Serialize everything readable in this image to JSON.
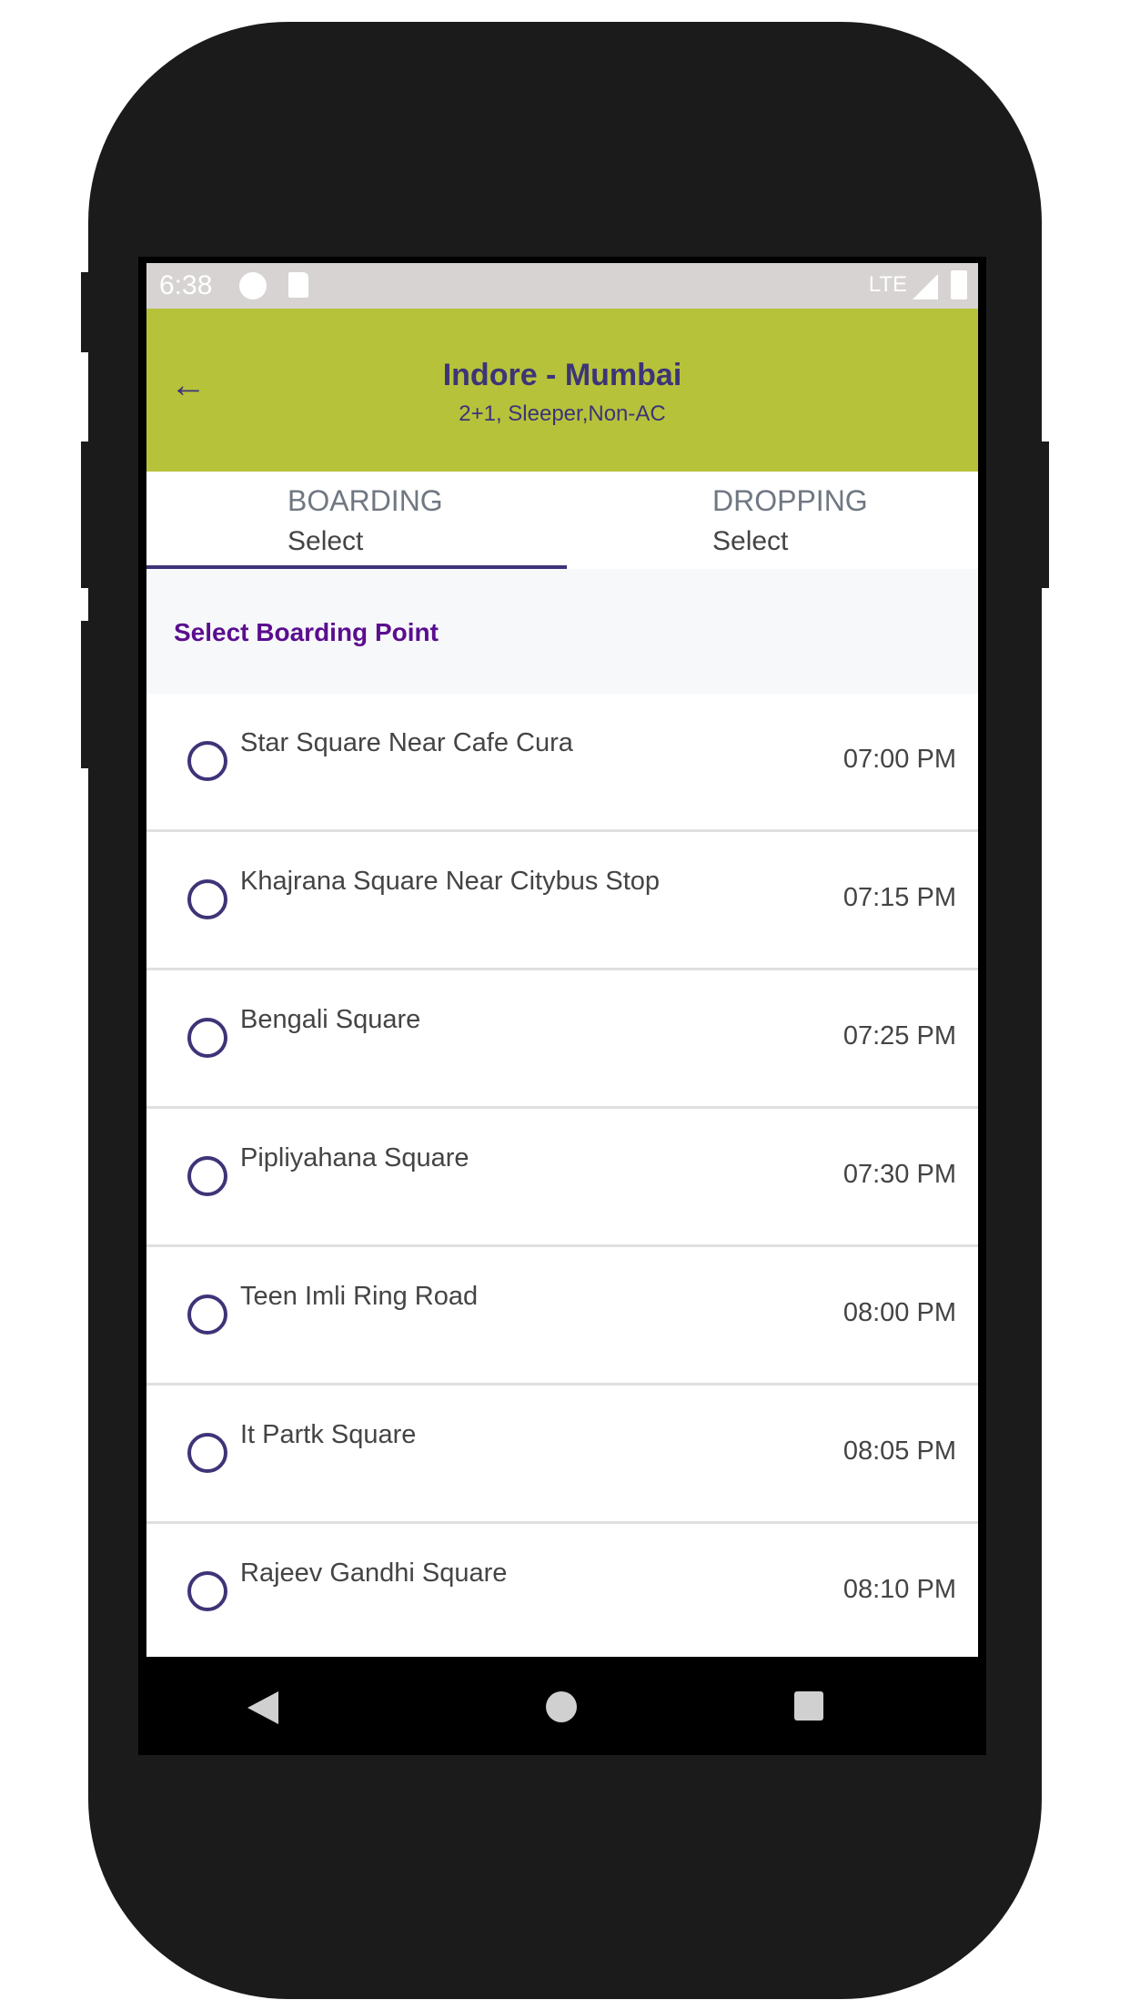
{
  "status_bar": {
    "time": "6:38",
    "network": "LTE",
    "icons": [
      "notification-icon",
      "sd-card-icon",
      "signal-icon",
      "battery-icon"
    ]
  },
  "header": {
    "title": "Indore - Mumbai",
    "subtitle": "2+1, Sleeper,Non-AC",
    "back_icon": "arrow-left-icon"
  },
  "tabs": [
    {
      "label": "BOARDING",
      "value": "Select",
      "active": true
    },
    {
      "label": "DROPPING",
      "value": "Select",
      "active": false
    }
  ],
  "section": {
    "heading": "Select Boarding Point"
  },
  "boarding_points": [
    {
      "name": "Star Square Near Cafe Cura",
      "time": "07:00 PM"
    },
    {
      "name": "Khajrana Square Near Citybus Stop",
      "time": "07:15 PM"
    },
    {
      "name": "Bengali Square",
      "time": "07:25 PM"
    },
    {
      "name": "Pipliyahana Square",
      "time": "07:30 PM"
    },
    {
      "name": "Teen Imli Ring Road",
      "time": "08:00 PM"
    },
    {
      "name": "It Partk Square",
      "time": "08:05 PM"
    },
    {
      "name": "Rajeev Gandhi Square",
      "time": "08:10 PM"
    }
  ],
  "colors": {
    "header": "#b6c23a",
    "accent": "#3d3478",
    "heading": "#5a0d8f"
  }
}
